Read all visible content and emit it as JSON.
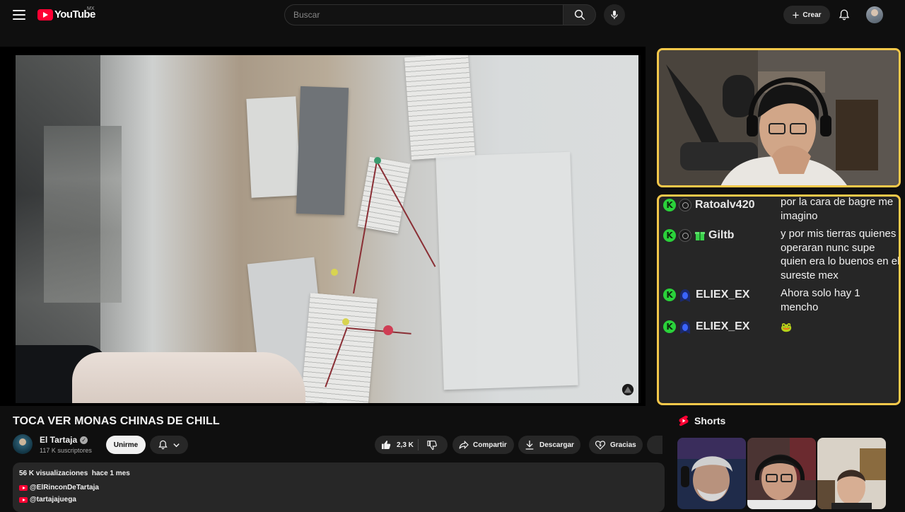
{
  "header": {
    "logo_text": "YouTube",
    "country_code": "MX",
    "search_placeholder": "Buscar",
    "create_label": "Crear"
  },
  "video": {
    "title": "TOCA VER MONAS CHINAS DE CHILL"
  },
  "channel": {
    "name": "El Tartaja",
    "subscribers": "117 K suscriptores",
    "join_label": "Unirme"
  },
  "actions": {
    "likes": "2,3 K",
    "share_label": "Compartir",
    "download_label": "Descargar",
    "thanks_label": "Gracias"
  },
  "description": {
    "views": "56 K visualizaciones",
    "date": "hace 1 mes",
    "links": [
      "@ElRinconDeTartaja",
      "@tartajajuega"
    ]
  },
  "chat": {
    "messages": [
      {
        "user": "Ratoalv420",
        "text": "por la cara de bagre me imagino",
        "badge": "user-icon"
      },
      {
        "user": "Giltb",
        "text": "y por mis tierras quienes operaran nunc supe quien era lo buenos en el sureste mex",
        "badge": "user-icon"
      },
      {
        "user": "ELIEX_EX",
        "text": "Ahora solo hay 1 mencho",
        "badge": "ghost-icon"
      },
      {
        "user": "ELIEX_EX",
        "text": "🐸",
        "badge": "ghost-icon"
      }
    ]
  },
  "shorts": {
    "title": "Shorts"
  },
  "colors": {
    "accent_red": "#ff0033",
    "overlay_border": "#f5c84a",
    "kick_green": "#2ad23a"
  }
}
